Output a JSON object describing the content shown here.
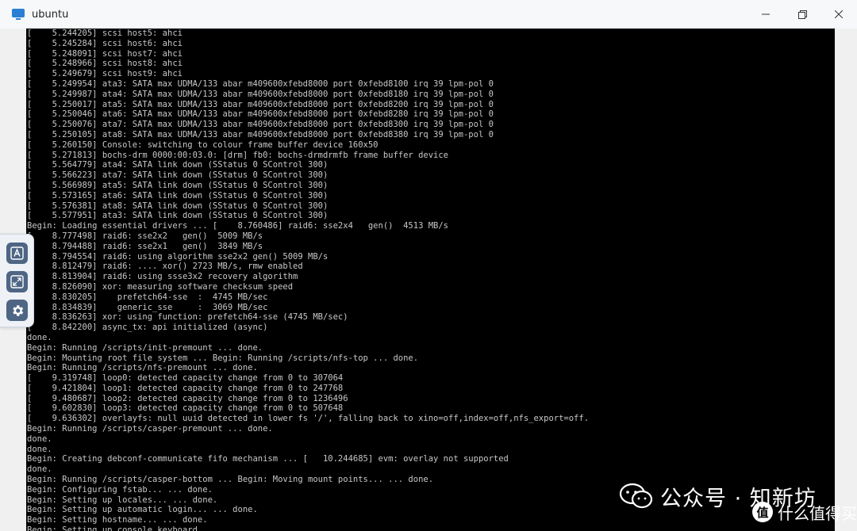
{
  "window": {
    "title": "ubuntu",
    "icons": {
      "app": "monitor-icon",
      "minimize": "minimize-icon",
      "maximize": "maximize-icon",
      "close": "close-icon"
    }
  },
  "toolbar": {
    "buttons": [
      {
        "icon": "keyboard-a-icon"
      },
      {
        "icon": "fit-screen-icon"
      },
      {
        "icon": "gear-icon"
      }
    ]
  },
  "terminal": {
    "lines": [
      "[    5.244205] scsi host5: ahci",
      "[    5.245284] scsi host6: ahci",
      "[    5.248091] scsi host7: ahci",
      "[    5.248966] scsi host8: ahci",
      "[    5.249679] scsi host9: ahci",
      "[    5.249954] ata3: SATA max UDMA/133 abar m409600xfebd8000 port 0xfebd8100 irq 39 lpm-pol 0",
      "[    5.249987] ata4: SATA max UDMA/133 abar m409600xfebd8000 port 0xfebd8180 irq 39 lpm-pol 0",
      "[    5.250017] ata5: SATA max UDMA/133 abar m409600xfebd8000 port 0xfebd8200 irq 39 lpm-pol 0",
      "[    5.250046] ata6: SATA max UDMA/133 abar m409600xfebd8000 port 0xfebd8280 irq 39 lpm-pol 0",
      "[    5.250076] ata7: SATA max UDMA/133 abar m409600xfebd8000 port 0xfebd8300 irq 39 lpm-pol 0",
      "[    5.250105] ata8: SATA max UDMA/133 abar m409600xfebd8000 port 0xfebd8380 irq 39 lpm-pol 0",
      "[    5.260150] Console: switching to colour frame buffer device 160x50",
      "[    5.271813] bochs-drm 0000:00:03.0: [drm] fb0: bochs-drmdrmfb frame buffer device",
      "[    5.564779] ata4: SATA link down (SStatus 0 SControl 300)",
      "[    5.566223] ata7: SATA link down (SStatus 0 SControl 300)",
      "[    5.566989] ata5: SATA link down (SStatus 0 SControl 300)",
      "[    5.573165] ata6: SATA link down (SStatus 0 SControl 300)",
      "[    5.576381] ata8: SATA link down (SStatus 0 SControl 300)",
      "[    5.577951] ata3: SATA link down (SStatus 0 SControl 300)",
      "Begin: Loading essential drivers ... [    8.760486] raid6: sse2x4   gen()  4513 MB/s",
      "[    8.777498] raid6: sse2x2   gen()  5009 MB/s",
      "[    8.794488] raid6: sse2x1   gen()  3849 MB/s",
      "[    8.794554] raid6: using algorithm sse2x2 gen() 5009 MB/s",
      "[    8.812479] raid6: .... xor() 2723 MB/s, rmw enabled",
      "[    8.813904] raid6: using ssse3x2 recovery algorithm",
      "[    8.826090] xor: measuring software checksum speed",
      "[    8.830205]    prefetch64-sse  :  4745 MB/sec",
      "[    8.834839]    generic_sse     :  3069 MB/sec",
      "[    8.836263] xor: using function: prefetch64-sse (4745 MB/sec)",
      "[    8.842200] async_tx: api initialized (async)",
      "done.",
      "Begin: Running /scripts/init-premount ... done.",
      "Begin: Mounting root file system ... Begin: Running /scripts/nfs-top ... done.",
      "Begin: Running /scripts/nfs-premount ... done.",
      "[    9.319748] loop0: detected capacity change from 0 to 307064",
      "[    9.421804] loop1: detected capacity change from 0 to 247768",
      "[    9.480687] loop2: detected capacity change from 0 to 1236496",
      "[    9.602830] loop3: detected capacity change from 0 to 507648",
      "[    9.636302] overlayfs: null uuid detected in lower fs '/', falling back to xino=off,index=off,nfs_export=off.",
      "Begin: Running /scripts/casper-premount ... done.",
      "done.",
      "done.",
      "Begin: Creating debconf-communicate fifo mechanism ... [   10.244685] evm: overlay not supported",
      "done.",
      "Begin: Running /scripts/casper-bottom ... Begin: Moving mount points... ... done.",
      "Begin: Configuring fstab... ... done.",
      "Begin: Setting up locales... ... done.",
      "Begin: Setting up automatic login... ... done.",
      "Begin: Setting hostname... ... done.",
      "Begin: Setting up console keyboard... ..."
    ]
  },
  "watermark": {
    "text": "公众号 · 知新坊",
    "icon": "wechat-icon",
    "brand_badge": "值",
    "brand_text": "什么值得买"
  }
}
